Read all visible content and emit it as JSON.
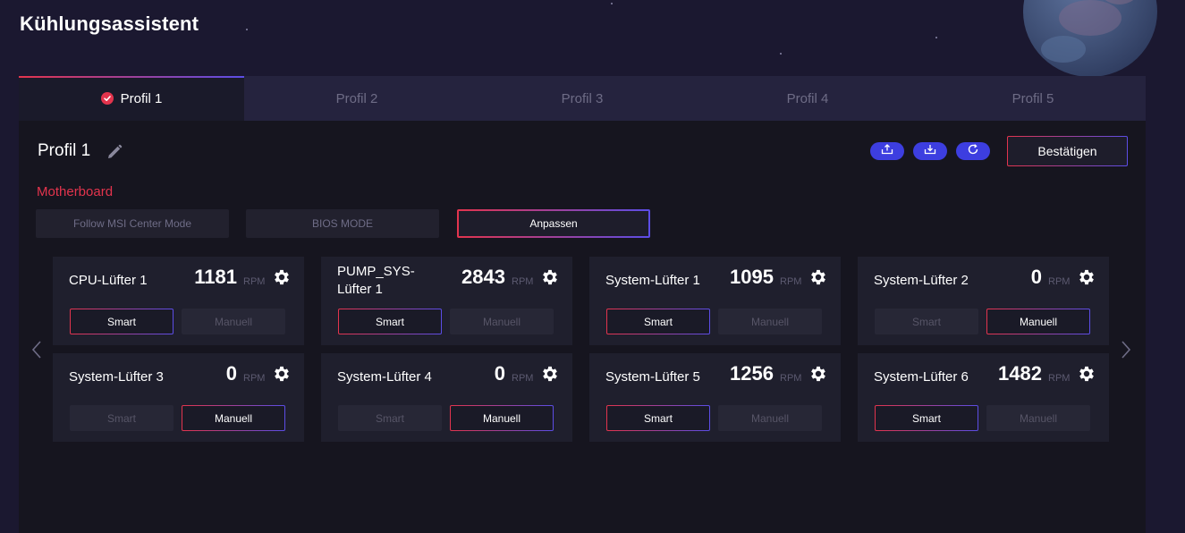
{
  "app": {
    "title": "Kühlungsassistent"
  },
  "tabs": [
    {
      "label": "Profil 1",
      "active": true
    },
    {
      "label": "Profil 2",
      "active": false
    },
    {
      "label": "Profil 3",
      "active": false
    },
    {
      "label": "Profil 4",
      "active": false
    },
    {
      "label": "Profil 5",
      "active": false
    }
  ],
  "profile": {
    "name": "Profil 1"
  },
  "toolbar": {
    "export_icon": "upload-icon",
    "import_icon": "download-icon",
    "reset_icon": "refresh-icon",
    "confirm_label": "Bestätigen"
  },
  "motherboard": {
    "title": "Motherboard",
    "modes": [
      {
        "label": "Follow MSI Center Mode",
        "active": false
      },
      {
        "label": "BIOS MODE",
        "active": false
      },
      {
        "label": "Anpassen",
        "active": true
      }
    ]
  },
  "fans": [
    {
      "name": "CPU-Lüfter 1",
      "rpm": "1181",
      "unit": "RPM",
      "mode": "Smart",
      "smart_label": "Smart",
      "manual_label": "Manuell"
    },
    {
      "name": "PUMP_SYS-Lüfter 1",
      "rpm": "2843",
      "unit": "RPM",
      "mode": "Smart",
      "smart_label": "Smart",
      "manual_label": "Manuell"
    },
    {
      "name": "System-Lüfter 1",
      "rpm": "1095",
      "unit": "RPM",
      "mode": "Smart",
      "smart_label": "Smart",
      "manual_label": "Manuell"
    },
    {
      "name": "System-Lüfter 2",
      "rpm": "0",
      "unit": "RPM",
      "mode": "Manuell",
      "smart_label": "Smart",
      "manual_label": "Manuell"
    },
    {
      "name": "System-Lüfter 3",
      "rpm": "0",
      "unit": "RPM",
      "mode": "Manuell",
      "smart_label": "Smart",
      "manual_label": "Manuell"
    },
    {
      "name": "System-Lüfter 4",
      "rpm": "0",
      "unit": "RPM",
      "mode": "Manuell",
      "smart_label": "Smart",
      "manual_label": "Manuell"
    },
    {
      "name": "System-Lüfter 5",
      "rpm": "1256",
      "unit": "RPM",
      "mode": "Smart",
      "smart_label": "Smart",
      "manual_label": "Manuell"
    },
    {
      "name": "System-Lüfter 6",
      "rpm": "1482",
      "unit": "RPM",
      "mode": "Smart",
      "smart_label": "Smart",
      "manual_label": "Manuell"
    }
  ],
  "colors": {
    "accent_red": "#e3344d",
    "accent_blue": "#3d3ee0",
    "background": "#1b1830"
  }
}
